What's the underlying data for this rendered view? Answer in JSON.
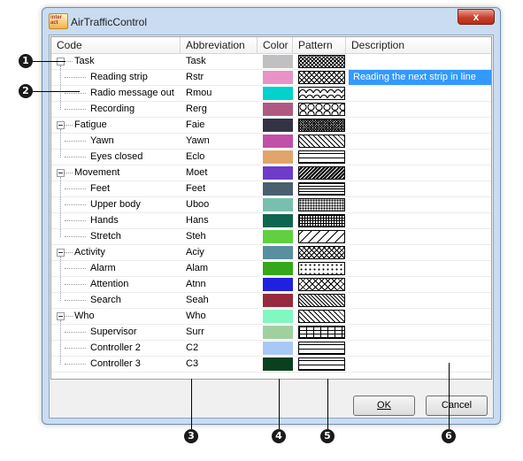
{
  "window": {
    "title": "AirTrafficControl",
    "close_glyph": "x",
    "icon_text": "inter act"
  },
  "columns": {
    "code": "Code",
    "abbreviation": "Abbreviation",
    "color": "Color",
    "pattern": "Pattern",
    "description": "Description"
  },
  "rows": [
    {
      "code": "Task",
      "abbr": "Task",
      "color": "#c0c0c0",
      "pattern": "cross-hatch",
      "level": 0,
      "description": ""
    },
    {
      "code": "Reading strip",
      "abbr": "Rstr",
      "color": "#e793c6",
      "pattern": "diag-cross",
      "level": 1,
      "description": "Reading the next strip in line"
    },
    {
      "code": "Radio message out",
      "abbr": "Rmou",
      "color": "#00d2cc",
      "pattern": "scales",
      "level": 1,
      "description": ""
    },
    {
      "code": "Recording",
      "abbr": "Rerg",
      "color": "#b05a82",
      "pattern": "circles",
      "level": 1,
      "description": ""
    },
    {
      "code": "Fatigue",
      "abbr": "Faie",
      "color": "#333346",
      "pattern": "diag-cross-dense",
      "level": 0,
      "description": ""
    },
    {
      "code": "Yawn",
      "abbr": "Yawn",
      "color": "#c050a8",
      "pattern": "diag-right",
      "level": 1,
      "description": ""
    },
    {
      "code": "Eyes closed",
      "abbr": "Eclo",
      "color": "#e0a46c",
      "pattern": "horizontal-wide",
      "level": 1,
      "description": ""
    },
    {
      "code": "Movement",
      "abbr": "Moet",
      "color": "#6d3cc8",
      "pattern": "diag-left-dense",
      "level": 0,
      "description": ""
    },
    {
      "code": "Feet",
      "abbr": "Feet",
      "color": "#4a606e",
      "pattern": "horizontal",
      "level": 1,
      "description": ""
    },
    {
      "code": "Upper body",
      "abbr": "Uboo",
      "color": "#78bfae",
      "pattern": "dots-dense",
      "level": 1,
      "description": ""
    },
    {
      "code": "Hands",
      "abbr": "Hans",
      "color": "#0e6650",
      "pattern": "grid",
      "level": 1,
      "description": ""
    },
    {
      "code": "Stretch",
      "abbr": "Steh",
      "color": "#60d040",
      "pattern": "diag-left-wide",
      "level": 1,
      "description": ""
    },
    {
      "code": "Activity",
      "abbr": "Aciy",
      "color": "#5890a0",
      "pattern": "diag-cross",
      "level": 0,
      "description": ""
    },
    {
      "code": "Alarm",
      "abbr": "Alam",
      "color": "#34a818",
      "pattern": "dots-sparse",
      "level": 1,
      "description": ""
    },
    {
      "code": "Attention",
      "abbr": "Atnn",
      "color": "#2020e0",
      "pattern": "diag-cross-wide",
      "level": 1,
      "description": ""
    },
    {
      "code": "Search",
      "abbr": "Seah",
      "color": "#982a40",
      "pattern": "diag-right-dense",
      "level": 1,
      "description": ""
    },
    {
      "code": "Who",
      "abbr": "Who",
      "color": "#80f8c0",
      "pattern": "diag-right",
      "level": 0,
      "description": ""
    },
    {
      "code": "Supervisor",
      "abbr": "Surr",
      "color": "#a0d0a0",
      "pattern": "brick",
      "level": 1,
      "description": ""
    },
    {
      "code": "Controller 2",
      "abbr": "C2",
      "color": "#a8c8f8",
      "pattern": "horizontal-wide",
      "level": 1,
      "description": ""
    },
    {
      "code": "Controller 3",
      "abbr": "C3",
      "color": "#0a4020",
      "pattern": "horizontal-wide",
      "level": 1,
      "description": ""
    }
  ],
  "buttons": {
    "ok": "OK",
    "cancel": "Cancel"
  },
  "callouts": [
    "1",
    "2",
    "3",
    "4",
    "5",
    "6"
  ]
}
